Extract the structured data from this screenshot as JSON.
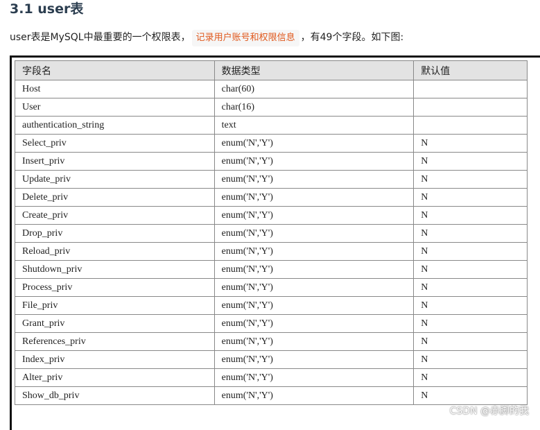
{
  "heading": "3.1 user表",
  "intro": {
    "before": "user表是MySQL中最重要的一个权限表，",
    "highlight": "记录用户账号和权限信息",
    "after": "，有49个字段。如下图:"
  },
  "table": {
    "headers": [
      "字段名",
      "数据类型",
      "默认值"
    ],
    "rows": [
      [
        "Host",
        "char(60)",
        ""
      ],
      [
        "User",
        "char(16)",
        ""
      ],
      [
        "authentication_string",
        "text",
        ""
      ],
      [
        "Select_priv",
        "enum('N','Y')",
        "N"
      ],
      [
        "Insert_priv",
        "enum('N','Y')",
        "N"
      ],
      [
        "Update_priv",
        "enum('N','Y')",
        "N"
      ],
      [
        "Delete_priv",
        "enum('N','Y')",
        "N"
      ],
      [
        "Create_priv",
        "enum('N','Y')",
        "N"
      ],
      [
        "Drop_priv",
        "enum('N','Y')",
        "N"
      ],
      [
        "Reload_priv",
        "enum('N','Y')",
        "N"
      ],
      [
        "Shutdown_priv",
        "enum('N','Y')",
        "N"
      ],
      [
        "Process_priv",
        "enum('N','Y')",
        "N"
      ],
      [
        "File_priv",
        "enum('N','Y')",
        "N"
      ],
      [
        "Grant_priv",
        "enum('N','Y')",
        "N"
      ],
      [
        "References_priv",
        "enum('N','Y')",
        "N"
      ],
      [
        "Index_priv",
        "enum('N','Y')",
        "N"
      ],
      [
        "Alter_priv",
        "enum('N','Y')",
        "N"
      ],
      [
        "Show_db_priv",
        "enum('N','Y')",
        "N"
      ]
    ]
  },
  "watermark": "CSDN @赤脚的我"
}
